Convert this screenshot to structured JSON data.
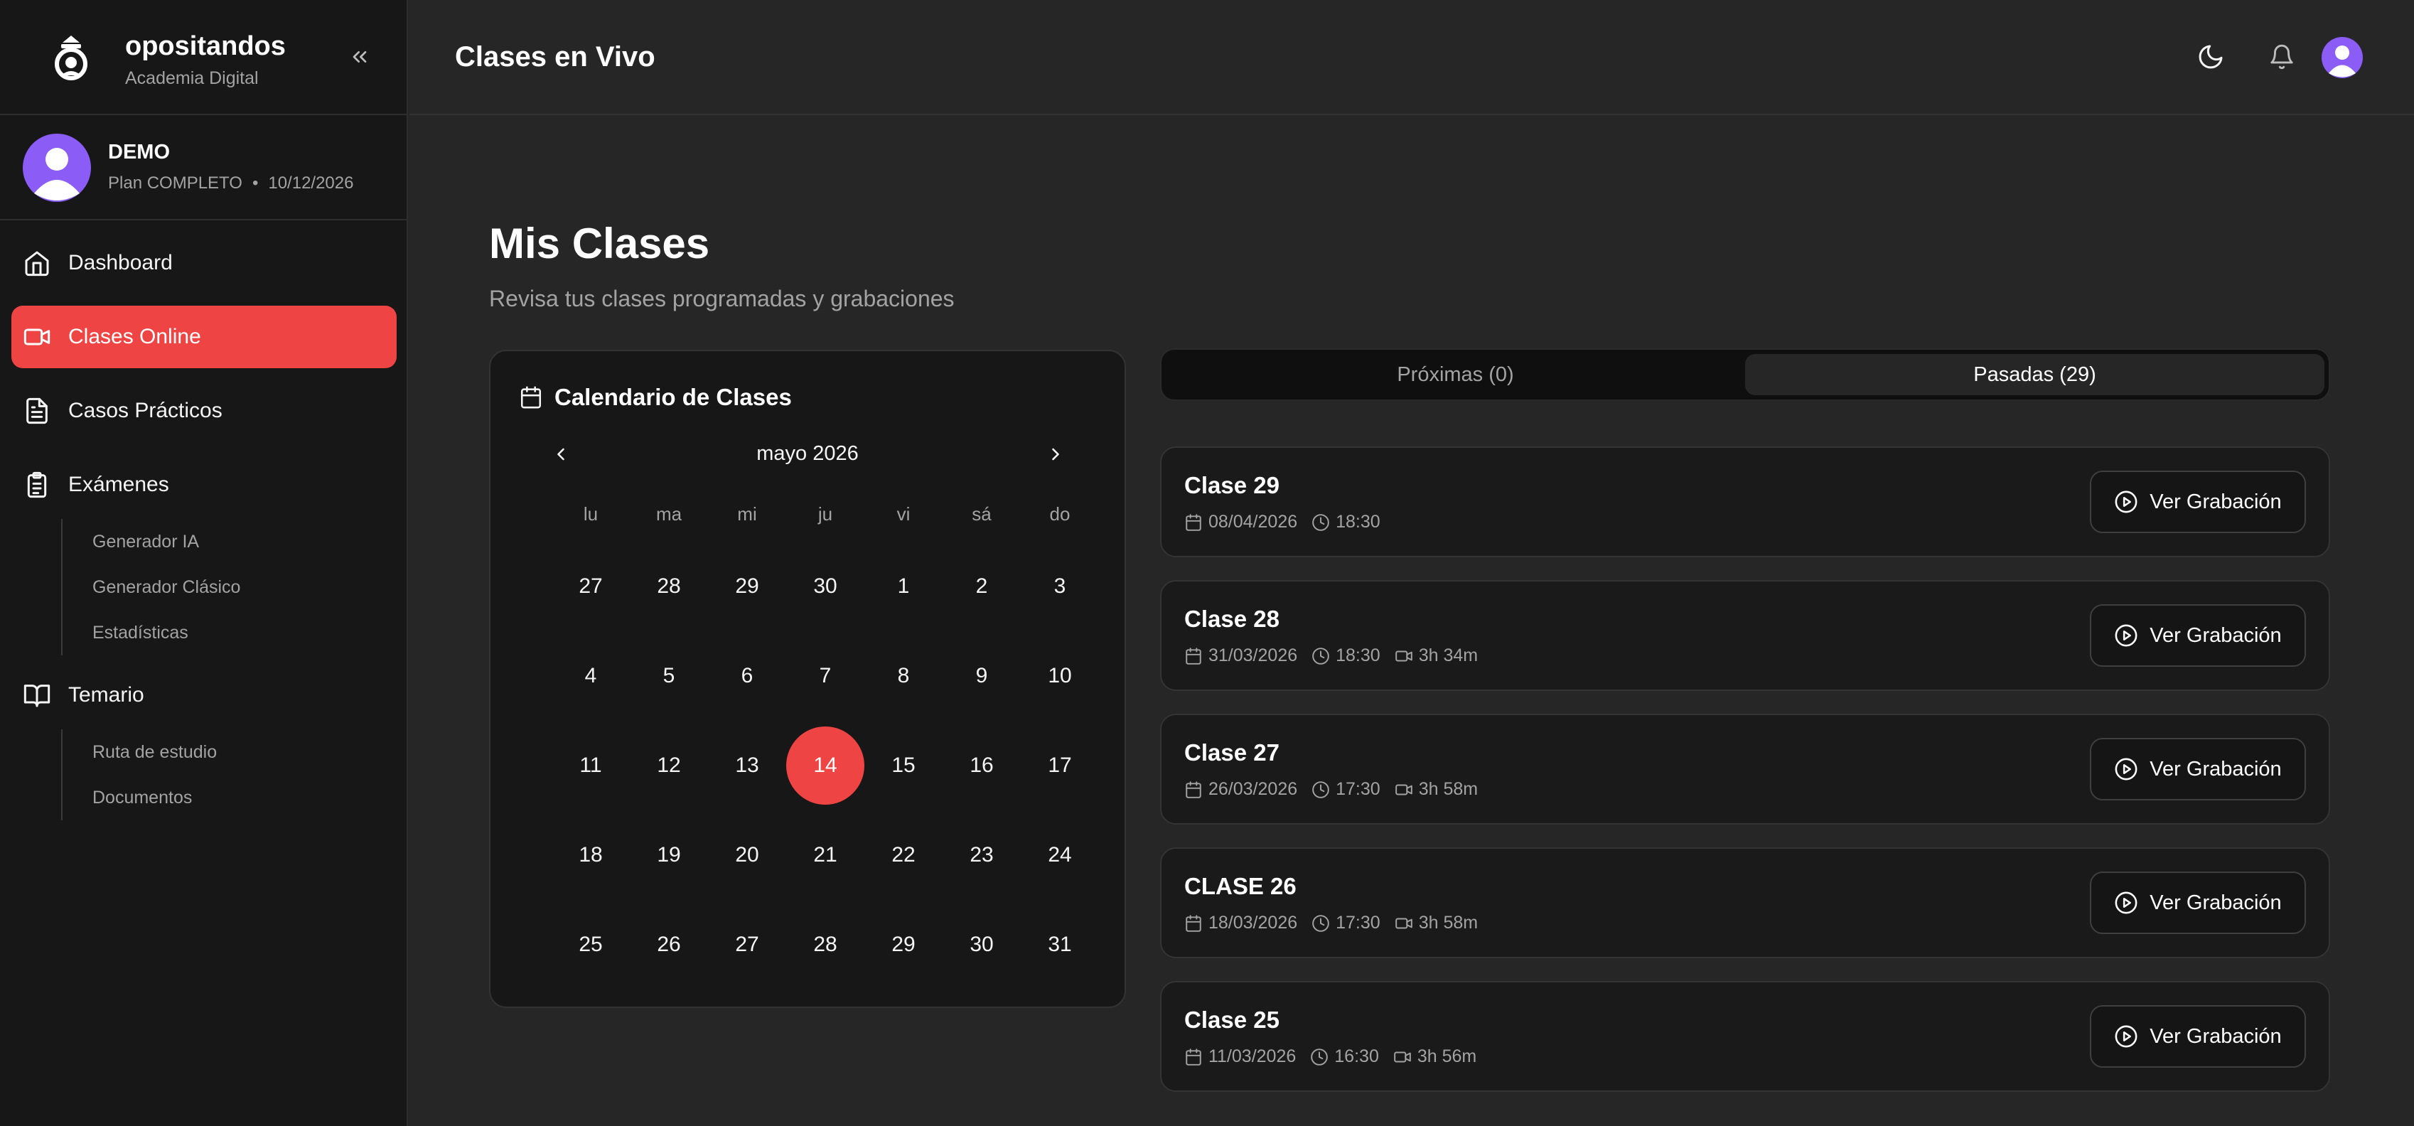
{
  "brand": {
    "name": "opositandos",
    "subtitle": "Academia Digital"
  },
  "user": {
    "name": "DEMO",
    "plan": "Plan COMPLETO",
    "separator": "•",
    "expires": "10/12/2026"
  },
  "sidebar": {
    "items": [
      {
        "label": "Dashboard",
        "icon": "home-icon"
      },
      {
        "label": "Clases Online",
        "icon": "video-icon",
        "active": true
      },
      {
        "label": "Casos Prácticos",
        "icon": "document-icon"
      },
      {
        "label": "Exámenes",
        "icon": "clipboard-icon",
        "children": [
          "Generador IA",
          "Generador Clásico",
          "Estadísticas"
        ]
      },
      {
        "label": "Temario",
        "icon": "book-icon",
        "children": [
          "Ruta de estudio",
          "Documentos"
        ]
      }
    ]
  },
  "header": {
    "title": "Clases en Vivo"
  },
  "page": {
    "title": "Mis Clases",
    "subtitle": "Revisa tus clases programadas y grabaciones"
  },
  "calendar": {
    "title": "Calendario de Clases",
    "month": "mayo 2026",
    "weekdays": [
      "lu",
      "ma",
      "mi",
      "ju",
      "vi",
      "sá",
      "do"
    ],
    "weeks": [
      [
        "27",
        "28",
        "29",
        "30",
        "1",
        "2",
        "3"
      ],
      [
        "4",
        "5",
        "6",
        "7",
        "8",
        "9",
        "10"
      ],
      [
        "11",
        "12",
        "13",
        "14",
        "15",
        "16",
        "17"
      ],
      [
        "18",
        "19",
        "20",
        "21",
        "22",
        "23",
        "24"
      ],
      [
        "25",
        "26",
        "27",
        "28",
        "29",
        "30",
        "31"
      ]
    ],
    "today": "14"
  },
  "tabs": [
    {
      "label": "Próximas (0)",
      "active": false
    },
    {
      "label": "Pasadas (29)",
      "active": true
    }
  ],
  "classes": [
    {
      "title": "Clase 29",
      "date": "08/04/2026",
      "time": "18:30",
      "duration": "",
      "button": "Ver Grabación"
    },
    {
      "title": "Clase 28",
      "date": "31/03/2026",
      "time": "18:30",
      "duration": "3h 34m",
      "button": "Ver Grabación"
    },
    {
      "title": "Clase 27",
      "date": "26/03/2026",
      "time": "17:30",
      "duration": "3h 58m",
      "button": "Ver Grabación"
    },
    {
      "title": "CLASE 26",
      "date": "18/03/2026",
      "time": "17:30",
      "duration": "3h 58m",
      "button": "Ver Grabación"
    },
    {
      "title": "Clase 25",
      "date": "11/03/2026",
      "time": "16:30",
      "duration": "3h 56m",
      "button": "Ver Grabación"
    }
  ],
  "colors": {
    "accent": "#ef4444",
    "sidebar_bg": "#171717",
    "main_bg": "#262626",
    "avatar": "#8b5cf6"
  }
}
